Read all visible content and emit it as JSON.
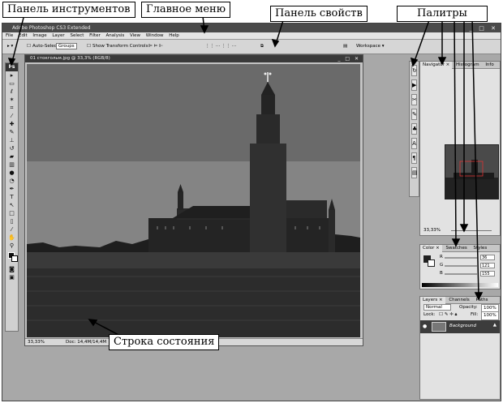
{
  "callouts": {
    "toolbar": "Панель инструментов",
    "main_menu": "Главное меню",
    "options_bar": "Панель свойств",
    "palettes": "Палитры",
    "status_bar": "Строка состояния"
  },
  "app": {
    "title": "Adobe Photoshop CS3 Extended",
    "menu": [
      "File",
      "Edit",
      "Image",
      "Layer",
      "Select",
      "Filter",
      "Analysis",
      "View",
      "Window",
      "Help"
    ],
    "options": {
      "auto_select_label": "Auto-Select:",
      "auto_select_value": "Groups",
      "show_transform_label": "Show Transform Controls",
      "workspace_label": "Workspace ▾"
    },
    "toolbox_logo": "Ps",
    "tools": [
      "move-tool-icon",
      "marquee-tool-icon",
      "lasso-tool-icon",
      "magic-wand-tool-icon",
      "crop-tool-icon",
      "eyedropper-tool-icon",
      "healing-brush-tool-icon",
      "brush-tool-icon",
      "clone-stamp-tool-icon",
      "history-brush-tool-icon",
      "eraser-tool-icon",
      "gradient-tool-icon",
      "blur-tool-icon",
      "dodge-tool-icon",
      "pen-tool-icon",
      "type-tool-icon",
      "path-selection-tool-icon",
      "shape-tool-icon",
      "notes-tool-icon",
      "eyedropper2-tool-icon",
      "hand-tool-icon",
      "zoom-tool-icon"
    ],
    "document": {
      "title": "01 стокгольм.jpg @ 33,3% (RGB/8)",
      "zoom": "33,33%",
      "doc_size": "Doc: 14,4M/14,4M"
    },
    "navigator": {
      "tabs": [
        "Navigator ×",
        "Histogram",
        "Info"
      ],
      "zoom": "33,33%"
    },
    "color": {
      "tabs": [
        "Color ×",
        "Swatches",
        "Styles"
      ],
      "r_label": "R",
      "g_label": "G",
      "b_label": "B",
      "r": "36",
      "g": "121",
      "b": "155"
    },
    "layers": {
      "tabs": [
        "Layers ×",
        "Channels",
        "Paths"
      ],
      "blend_mode": "Normal",
      "opacity_label": "Opacity:",
      "opacity": "100%",
      "lock_label": "Lock:",
      "fill_label": "Fill:",
      "fill": "100%",
      "layer_name": "Background"
    }
  }
}
